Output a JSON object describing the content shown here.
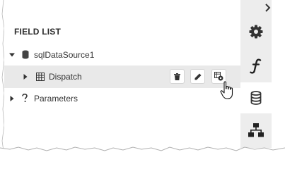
{
  "panel": {
    "title": "FIELD LIST"
  },
  "tree": {
    "datasource": {
      "label": "sqlDataSource1",
      "icon": "database-icon",
      "expander": "expanded"
    },
    "dispatch": {
      "label": "Dispatch",
      "icon": "table-icon",
      "expander": "collapsed",
      "selected": true
    },
    "parameters": {
      "label": "Parameters",
      "icon": "question-icon",
      "expander": "collapsed"
    }
  },
  "row_actions": [
    {
      "name": "delete",
      "icon": "trash-icon"
    },
    {
      "name": "rename",
      "icon": "pencil-icon"
    },
    {
      "name": "edit-query",
      "icon": "edit-query-icon"
    }
  ],
  "toolbar": {
    "tabs": [
      {
        "name": "properties",
        "icon": "gear-icon",
        "active": false
      },
      {
        "name": "expressions",
        "icon": "function-icon",
        "active": false
      },
      {
        "name": "field-list",
        "icon": "database-icon",
        "active": true
      },
      {
        "name": "report-explorer",
        "icon": "hierarchy-icon",
        "active": false
      }
    ]
  },
  "colors": {
    "toolbar_bg": "#ededed",
    "selected_row_bg": "#e9e9e9",
    "icon_dark": "#333333"
  }
}
